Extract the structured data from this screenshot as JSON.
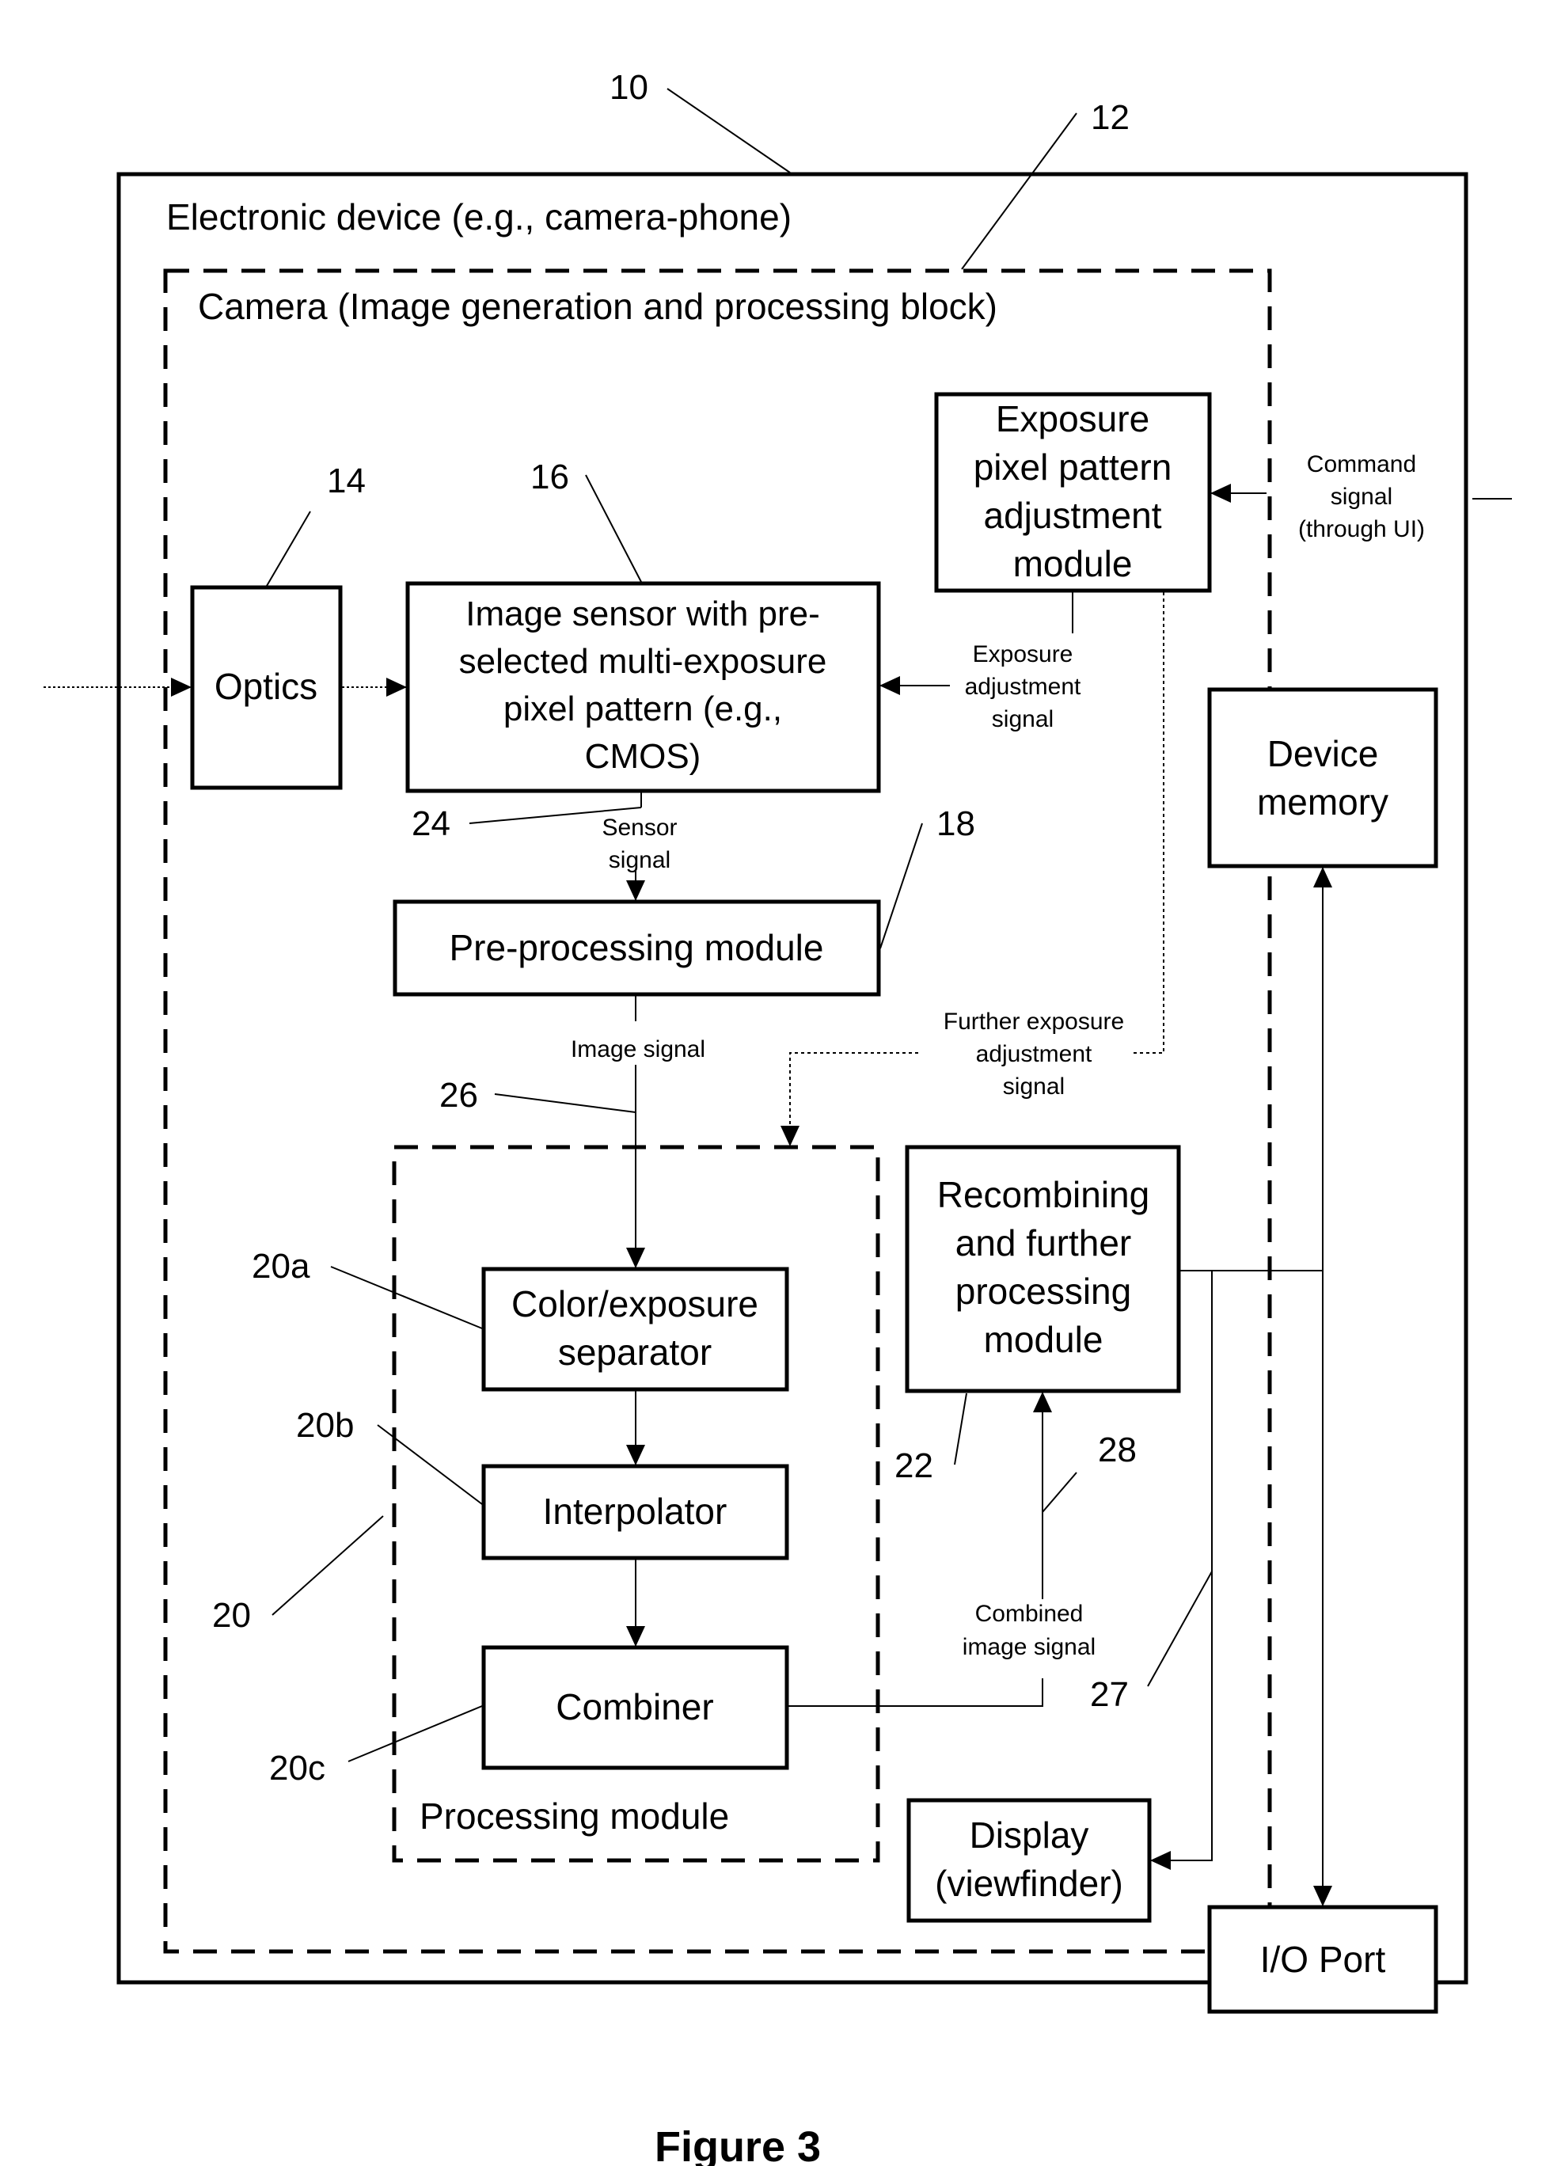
{
  "figure_title": "Figure 3",
  "containers": {
    "device": {
      "ref": "10",
      "label": "Electronic device (e.g., camera-phone)"
    },
    "camera": {
      "ref": "12",
      "label": "Camera (Image generation and processing block)"
    },
    "processing": {
      "ref": "20",
      "label": "Processing module"
    }
  },
  "blocks": {
    "optics": {
      "ref": "14",
      "lines": [
        "Optics"
      ]
    },
    "sensor": {
      "ref": "16",
      "lines": [
        "Image sensor with pre-",
        "selected multi-exposure",
        "pixel pattern (e.g.,",
        "CMOS)"
      ]
    },
    "exposure": {
      "lines": [
        "Exposure",
        "pixel pattern",
        "adjustment",
        "module"
      ]
    },
    "preprocessing": {
      "ref": "18",
      "lines": [
        "Pre-processing module"
      ]
    },
    "memory": {
      "lines": [
        "Device",
        "memory"
      ]
    },
    "separator": {
      "ref": "20a",
      "lines": [
        "Color/exposure",
        "separator"
      ]
    },
    "interpolator": {
      "ref": "20b",
      "lines": [
        "Interpolator"
      ]
    },
    "combiner": {
      "ref": "20c",
      "lines": [
        "Combiner"
      ]
    },
    "recombining": {
      "ref": "22",
      "lines": [
        "Recombining",
        "and further",
        "processing",
        "module"
      ]
    },
    "display": {
      "lines": [
        "Display",
        "(viewfinder)"
      ]
    },
    "io": {
      "lines": [
        "I/O Port"
      ]
    }
  },
  "signals": {
    "command": [
      "Command",
      "signal",
      "(through UI)"
    ],
    "exposure_adj": [
      "Exposure",
      "adjustment",
      "signal"
    ],
    "sensor": {
      "ref": "24",
      "lines": [
        "Sensor",
        "signal"
      ]
    },
    "image": {
      "ref": "26",
      "lines": [
        "Image signal"
      ]
    },
    "further": [
      "Further exposure",
      "adjustment",
      "signal"
    ],
    "combined": {
      "ref": "28",
      "lines": [
        "Combined",
        "image signal"
      ]
    },
    "output_ref": "27"
  }
}
